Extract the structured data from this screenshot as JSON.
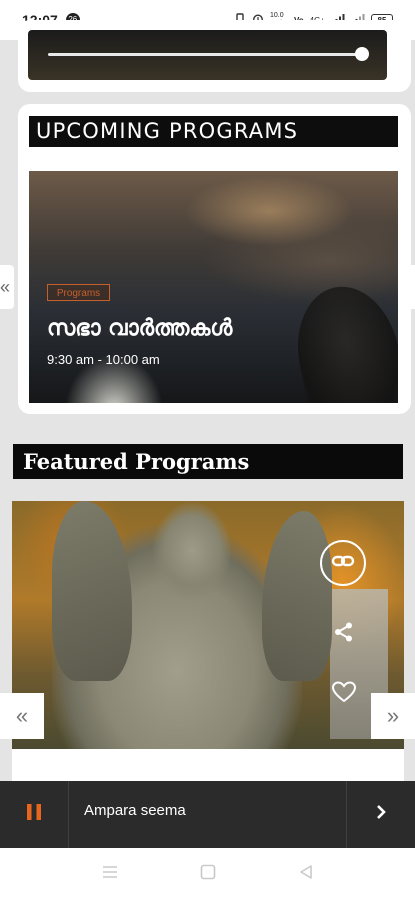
{
  "status_bar": {
    "time": "12:07",
    "notification_badge": "26",
    "network_speed": "10.0 KB/S",
    "network_type": "4G+",
    "battery": "85"
  },
  "player": {
    "progress": 0.99
  },
  "upcoming": {
    "section_title": "UPCOMING PROGRAMS",
    "program": {
      "category": "Programs",
      "title": "സഭാ വാർത്തകൾ",
      "time": "9:30 am - 10:00 am"
    },
    "prev_glyph": "«"
  },
  "featured": {
    "section_title": "Featured Programs",
    "prev_glyph": "«",
    "next_glyph": "»"
  },
  "mini_player": {
    "now_playing": "Ampara seema"
  },
  "colors": {
    "accent": "#c5602b",
    "pause": "#e8651e",
    "player_bg": "#2b2b2b",
    "page_bg": "#e4e4e4"
  }
}
